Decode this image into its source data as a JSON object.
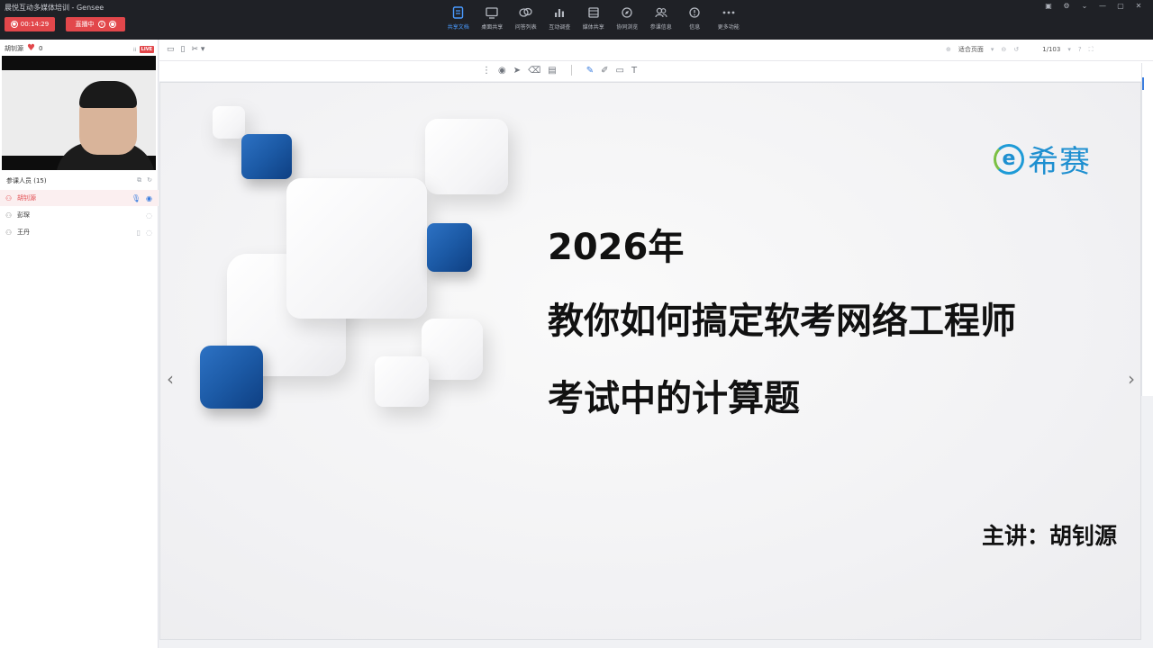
{
  "window": {
    "title": "晨悦互动多媒体培训 - Gensee"
  },
  "recording": {
    "time": "00:14:29",
    "live_label": "直播中"
  },
  "toolbar": {
    "items": [
      {
        "label": "共享文档",
        "icon": "document-icon",
        "active": true
      },
      {
        "label": "桌面共享",
        "icon": "desktop-icon"
      },
      {
        "label": "问答列表",
        "icon": "qa-icon"
      },
      {
        "label": "互动调查",
        "icon": "survey-chart-icon"
      },
      {
        "label": "媒体共享",
        "icon": "media-icon"
      },
      {
        "label": "协同浏览",
        "icon": "browse-icon"
      },
      {
        "label": "参课信息",
        "icon": "users-icon"
      },
      {
        "label": "信息",
        "icon": "info-icon"
      },
      {
        "label": "更多功能",
        "icon": "more-icon"
      }
    ]
  },
  "presenter": {
    "name": "胡钊源",
    "likes": "0",
    "badge": "LIVE"
  },
  "attendees": {
    "header": "参课人员 (15)",
    "items": [
      {
        "name": "胡钊源",
        "role": "host"
      },
      {
        "name": "彭琛"
      },
      {
        "name": "王丹"
      }
    ]
  },
  "doc": {
    "zoom_label": "适合页面",
    "page": "1/103"
  },
  "slide": {
    "line1": "2026年",
    "line2": "教你如何搞定软考网络工程师",
    "line3": "考试中的计算题",
    "speaker": "主讲：胡钊源",
    "logo_text": "希赛",
    "logo_mark": "e"
  },
  "colors": {
    "accent": "#e2474b",
    "brand_blue": "#1e8fd0",
    "toolbar_active": "#4a9bff"
  }
}
